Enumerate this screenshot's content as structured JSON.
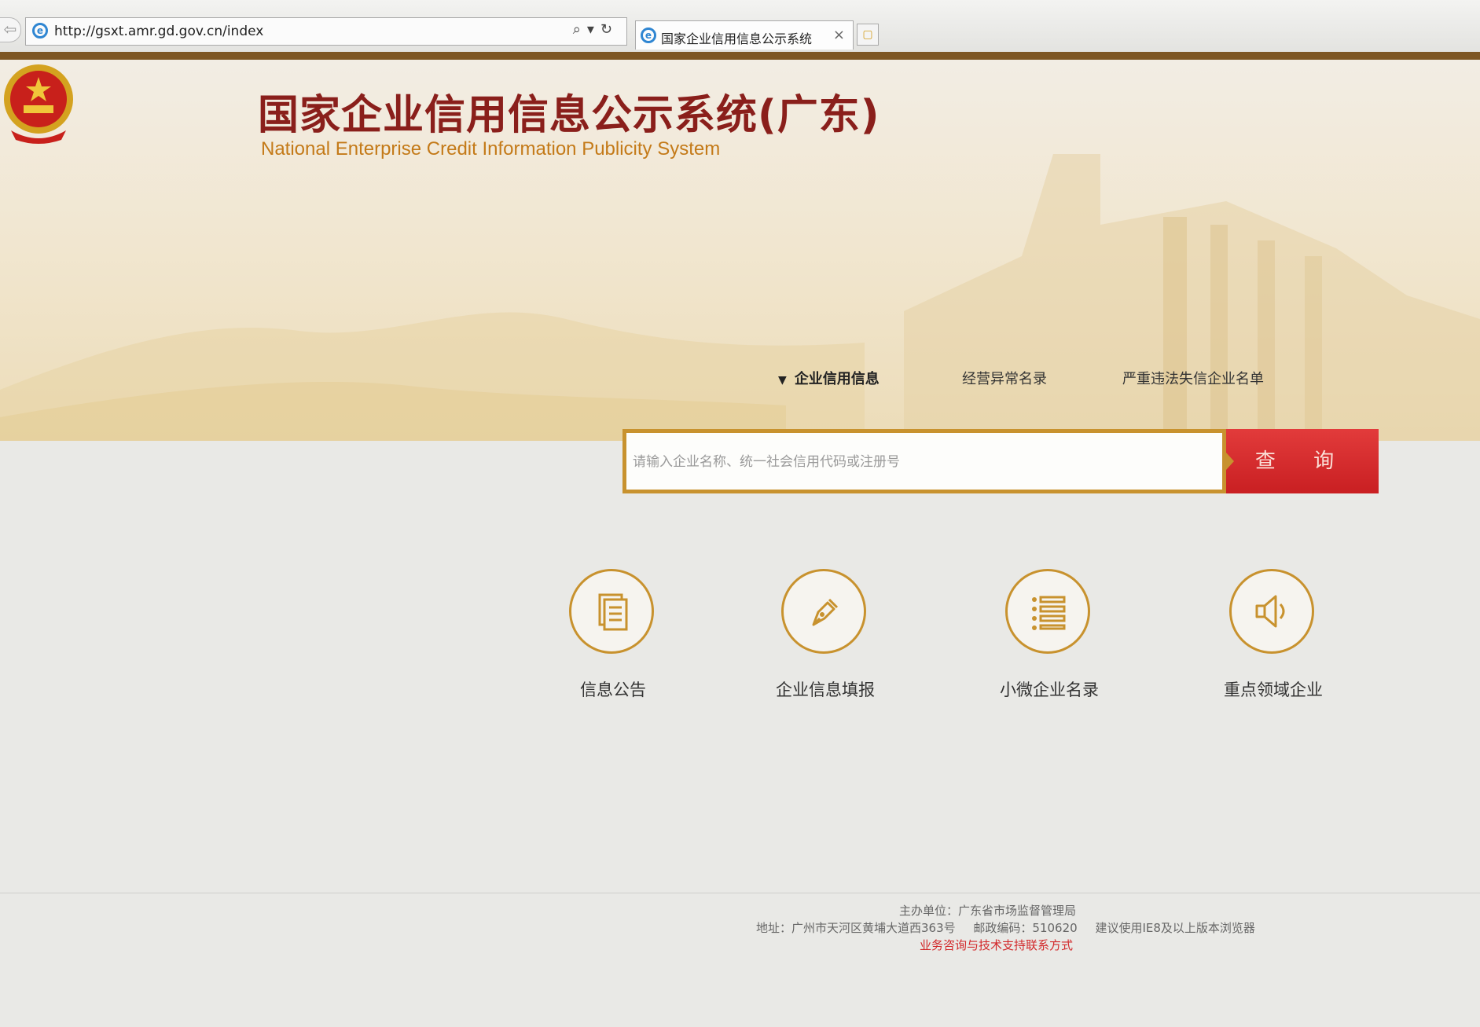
{
  "browser": {
    "url": "http://gsxt.amr.gd.gov.cn/index",
    "tab_title": "国家企业信用信息公示系统",
    "tab_close": "×"
  },
  "header": {
    "title": "国家企业信用信息公示系统(广东)",
    "subtitle": "National Enterprise Credit Information Publicity System"
  },
  "search": {
    "tabs": [
      {
        "label": "企业信用信息",
        "active": true
      },
      {
        "label": "经营异常名录",
        "active": false
      },
      {
        "label": "严重违法失信企业名单",
        "active": false
      }
    ],
    "placeholder": "请输入企业名称、统一社会信用代码或注册号",
    "button_label": "查 询"
  },
  "quick_links": [
    {
      "label": "信息公告",
      "icon": "document-icon"
    },
    {
      "label": "企业信息填报",
      "icon": "pen-icon"
    },
    {
      "label": "小微企业名录",
      "icon": "list-icon"
    },
    {
      "label": "重点领域企业",
      "icon": "speaker-icon"
    }
  ],
  "footer": {
    "sponsor": "主办单位：广东省市场监督管理局",
    "address": "地址：广州市天河区黄埔大道西363号",
    "postcode": "邮政编码：510620",
    "browser_tip": "建议使用IE8及以上版本浏览器",
    "contact_link": "业务咨询与技术支持联系方式"
  },
  "colors": {
    "accent_gold": "#c8922e",
    "title_red": "#8a1f1b",
    "button_red": "#d8282b",
    "top_bar_brown": "#7d5624"
  }
}
